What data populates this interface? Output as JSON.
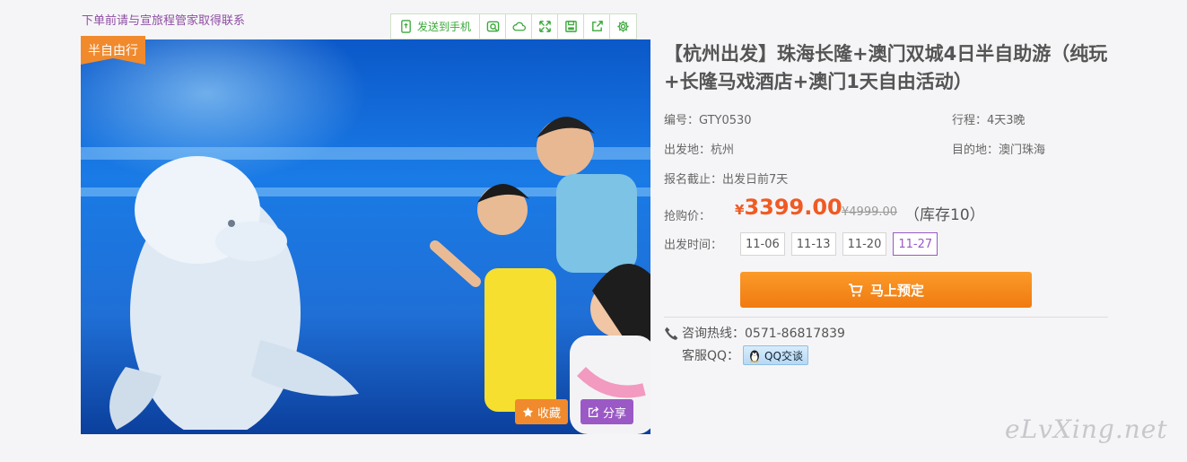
{
  "notice": "下单前请与宣旅程管家取得联系",
  "toolbar": {
    "send_label": "发送到手机",
    "icons": [
      "phone-send-icon",
      "camera-icon",
      "cloud-icon",
      "expand-icon",
      "save-icon",
      "share-out-icon",
      "settings-icon"
    ]
  },
  "photo": {
    "tag": "半自由行",
    "fav_label": "收藏",
    "share_label": "分享"
  },
  "product": {
    "title": "【杭州出发】珠海长隆+澳门双城4日半自助游（纯玩+长隆马戏酒店+澳门1天自由活动）",
    "code": "编号：GTY0530",
    "duration": "行程：4天3晚",
    "departure": "出发地：杭州",
    "destination": "目的地：澳门珠海",
    "deadline": "报名截止：出发日前7天",
    "price_label": "抢购价：",
    "currency": "¥",
    "price": "3399.00",
    "original_price": "¥4999.00",
    "stock": "（库存10）",
    "date_label": "出发时间：",
    "dates": [
      "11-06",
      "11-13",
      "11-20",
      "11-27"
    ],
    "selected_date": "11-27",
    "book_label": "马上预定"
  },
  "contact": {
    "hotline": "咨询热线：0571-86817839",
    "qq_label": "客服QQ：",
    "qq_button": "QQ交谈"
  },
  "watermark": "eLvXing.net",
  "colors": {
    "accent_orange": "#f08a2d",
    "price_red": "#f05a23",
    "purple": "#9b59c6",
    "toolbar_green": "#3ba93b"
  }
}
